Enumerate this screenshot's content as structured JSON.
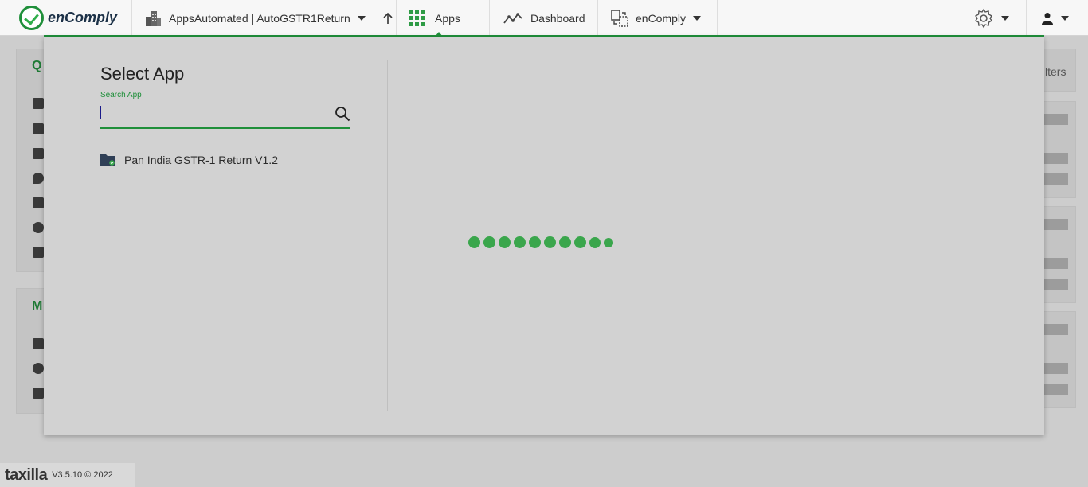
{
  "header": {
    "brand": "enComply",
    "workspace_label": "AppsAutomated | AutoGSTR1Return",
    "apps_label": "Apps",
    "dashboard_label": "Dashboard",
    "encomply_label": "enComply"
  },
  "background": {
    "card1_heading_fragment": "Q",
    "card2_heading_fragment": "M",
    "filters_fragment": "lters"
  },
  "panel": {
    "title": "Select App",
    "search_label": "Search App",
    "search_value": "",
    "apps": [
      {
        "label": "Pan India GSTR-1 Return V1.2"
      }
    ],
    "loader_dots": 10
  },
  "footer": {
    "brand": "taxilla",
    "version": "V3.5.10 © 2022"
  },
  "colors": {
    "accent": "#1f8f3a",
    "loader": "#3aa64c",
    "overlay": "#d2d2d2"
  },
  "icons": [
    "logo-check-icon",
    "building-icon",
    "caret-down-icon",
    "arrow-up-icon",
    "apps-grid-icon",
    "dashboard-trend-icon",
    "switch-app-icon",
    "gear-icon",
    "user-icon",
    "search-icon",
    "folder-app-icon"
  ]
}
